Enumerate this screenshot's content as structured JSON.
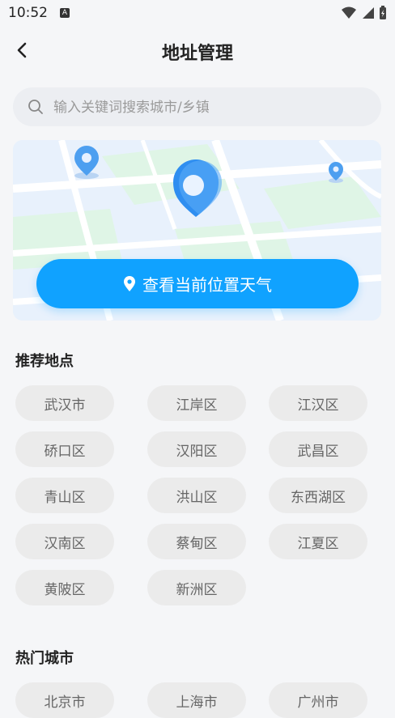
{
  "status": {
    "time": "10:52",
    "notif_icon": "A"
  },
  "header": {
    "title": "地址管理"
  },
  "search": {
    "placeholder": "输入关键词搜索城市/乡镇"
  },
  "locate": {
    "label": "查看当前位置天气"
  },
  "recommended": {
    "title": "推荐地点",
    "items": [
      "武汉市",
      "江岸区",
      "江汉区",
      "硚口区",
      "汉阳区",
      "武昌区",
      "青山区",
      "洪山区",
      "东西湖区",
      "汉南区",
      "蔡甸区",
      "江夏区",
      "黄陂区",
      "新洲区"
    ]
  },
  "hot": {
    "title": "热门城市",
    "items": [
      "北京市",
      "上海市",
      "广州市"
    ]
  },
  "colors": {
    "accent": "#10a2ff",
    "chip_bg": "#ebebeb",
    "page_bg": "#f5f6f8"
  }
}
